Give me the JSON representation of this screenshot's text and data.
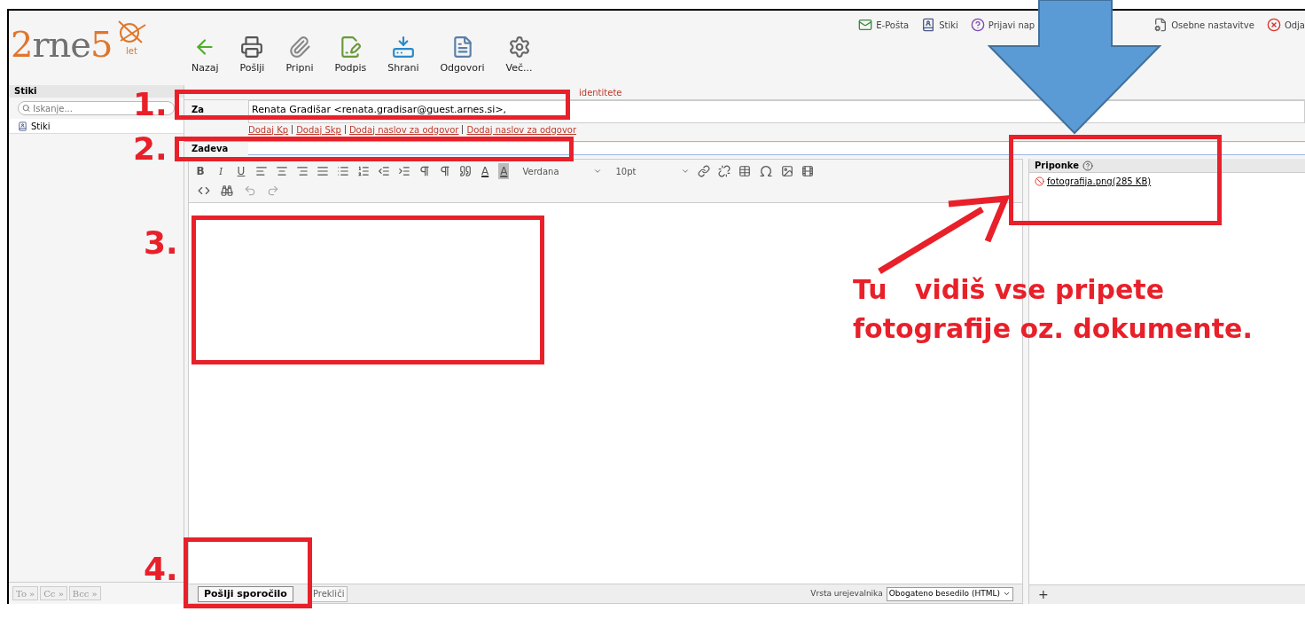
{
  "logo": {
    "text": "2rne5",
    "sub": "let"
  },
  "toolbar": [
    {
      "label": "Nazaj",
      "kind": "back"
    },
    {
      "label": "Pošlji",
      "kind": "send"
    },
    {
      "label": "Pripni",
      "kind": "attach"
    },
    {
      "label": "Podpis",
      "kind": "signature"
    },
    {
      "label": "Shrani",
      "kind": "save"
    },
    {
      "label": "Odgovori",
      "kind": "reply"
    },
    {
      "label": "Več...",
      "kind": "more"
    }
  ],
  "top_links": [
    {
      "label": "E-Pošta",
      "kind": "mail"
    },
    {
      "label": "Stiki",
      "kind": "contacts"
    },
    {
      "label": "Prijavi nap",
      "kind": "help"
    },
    {
      "label": "Osebne nastavitve",
      "kind": "settings"
    },
    {
      "label": "Odja",
      "kind": "logout"
    }
  ],
  "sidebar": {
    "title": "Stiki",
    "search": {
      "placeholder": "Iskanje..."
    },
    "items": [
      {
        "label": "Stiki"
      }
    ],
    "recipient_buttons": [
      "To »",
      "Cc »",
      "Bcc »"
    ]
  },
  "compose": {
    "from_link": "identitete",
    "to": {
      "label": "Za",
      "value": "Renata Gradišar <renata.gradisar@guest.arnes.si>,"
    },
    "links": [
      "Dodaj Kp",
      "Dodaj Skp",
      "Dodaj naslov za odgovor",
      "Dodaj naslov za odgovor"
    ],
    "subject": {
      "label": "Zadeva"
    },
    "format_buttons": [
      {
        "label": "B",
        "kind": "bold"
      },
      {
        "label": "I",
        "kind": "italic"
      },
      {
        "label": "U",
        "kind": "underline"
      }
    ],
    "color_buttons": [
      "A",
      "A"
    ],
    "font": "Verdana",
    "size": "10pt",
    "send": "Pošlji sporočilo",
    "cancel": "Prekliči",
    "editor_type": {
      "label": "Vrsta urejevalnika",
      "value": "Obogateno besedilo (HTML)"
    }
  },
  "attachments": {
    "title": "Priponke",
    "items": [
      {
        "name": "fotografija.png",
        "size": "(285 KB)"
      }
    ],
    "add": "+"
  },
  "annotations": {
    "markers": [
      "1.",
      "2.",
      "3.",
      "4."
    ],
    "note_lines": [
      "Tu   vidiš vse pripete",
      "fotografije oz. dokumente."
    ]
  }
}
